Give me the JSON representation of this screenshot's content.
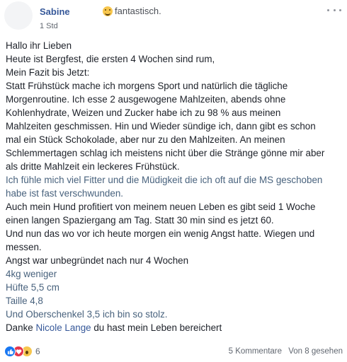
{
  "post": {
    "author": "Sabine",
    "feeling": "fantastisch.",
    "timestamp": "1 Std",
    "lines": [
      {
        "text": "Hallo ihr Lieben",
        "style": "normal"
      },
      {
        "text": "Heute ist Bergfest, die ersten 4 Wochen sind rum,",
        "style": "normal"
      },
      {
        "text": "Mein Fazit bis Jetzt:",
        "style": "normal"
      },
      {
        "text": "Statt Frühstück mache ich morgens Sport und natürlich die tägliche",
        "style": "normal"
      },
      {
        "text": "Morgenroutine. Ich esse 2 ausgewogene Mahlzeiten, abends ohne",
        "style": "normal"
      },
      {
        "text": "Kohlenhydrate, Weizen und Zucker habe ich zu 98 % aus meinen",
        "style": "normal"
      },
      {
        "text": "Mahlzeiten geschmissen. Hin und Wieder sündige ich, dann gibt es schon",
        "style": "normal"
      },
      {
        "text": "mal ein Stück Schokolade, aber nur zu den Mahlzeiten. An meinen",
        "style": "normal"
      },
      {
        "text": "Schlemmertagen schlag ich meistens nicht über die Stränge gönne mir aber",
        "style": "normal"
      },
      {
        "text": "als dritte Mahlzeit ein leckeres Frühstück.",
        "style": "normal"
      },
      {
        "text": "Ich fühle mich viel Fitter und die Müdigkeit die ich oft auf die MS geschoben",
        "style": "faded"
      },
      {
        "text": "habe ist fast verschwunden.",
        "style": "faded"
      },
      {
        "text": "Auch mein Hund profitiert von meinem neuen Leben es gibt seid 1 Woche",
        "style": "normal"
      },
      {
        "text": "einen langen Spaziergang am Tag. Statt 30 min sind es jetzt 60.",
        "style": "normal"
      },
      {
        "text": "Und nun das wo vor ich heute morgen ein wenig Angst hatte. Wiegen und",
        "style": "normal"
      },
      {
        "text": "messen.",
        "style": "normal"
      },
      {
        "text": "Angst war unbegründet nach nur 4 Wochen",
        "style": "normal"
      },
      {
        "text": "4kg weniger",
        "style": "faded"
      },
      {
        "text": "Hüfte 5,5 cm",
        "style": "faded"
      },
      {
        "text": "Taille 4,8",
        "style": "faded"
      },
      {
        "text": "Und Oberschenkel 3,5 ich bin so stolz.",
        "style": "faded"
      }
    ],
    "closing": {
      "prefix": "Danke ",
      "mention": "Nicole Lange",
      "suffix": " du hast mein Leben bereichert"
    }
  },
  "footer": {
    "reaction_icons": [
      "like-icon",
      "love-icon",
      "wow-icon"
    ],
    "reaction_count": "6",
    "comments": "5 Kommentare",
    "seen": "Von 8 gesehen"
  },
  "colors": {
    "author": "#365899",
    "text": "#1d2129",
    "meta": "#616770",
    "like": "#1877f2",
    "love": "#e5354c"
  }
}
